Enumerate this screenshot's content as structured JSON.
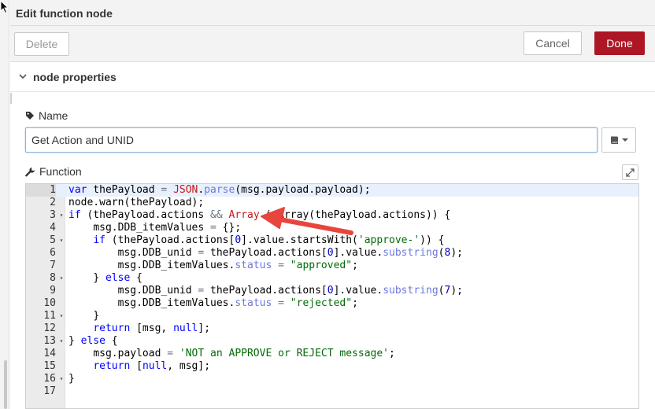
{
  "dialog": {
    "title": "Edit function node"
  },
  "toolbar": {
    "delete_label": "Delete",
    "cancel_label": "Cancel",
    "done_label": "Done"
  },
  "section": {
    "label": "node properties"
  },
  "name_field": {
    "label": "Name",
    "value": "Get Action and UNID"
  },
  "function_field": {
    "label": "Function"
  },
  "editor": {
    "line_numbers": [
      "1",
      "2",
      "3",
      "4",
      "5",
      "6",
      "7",
      "8",
      "9",
      "10",
      "11",
      "12",
      "13",
      "14",
      "15",
      "16",
      "17"
    ],
    "lines": [
      [
        [
          "k",
          "var"
        ],
        [
          "t",
          " thePayload "
        ],
        [
          "o",
          "="
        ],
        [
          "t",
          " "
        ],
        [
          "b",
          "JSON"
        ],
        [
          "t",
          "."
        ],
        [
          "c",
          "parse"
        ],
        [
          "t",
          "(msg.payload.payload);"
        ]
      ],
      [
        [
          "t",
          "node.warn(thePayload);"
        ]
      ],
      [
        [
          "k",
          "if"
        ],
        [
          "t",
          " (thePayload.actions "
        ],
        [
          "o",
          "&&"
        ],
        [
          "t",
          " "
        ],
        [
          "b",
          "Array"
        ],
        [
          "t",
          ".isArray(thePayload.actions)) {"
        ]
      ],
      [
        [
          "i",
          "    "
        ],
        [
          "t",
          "msg.DDB_itemValues "
        ],
        [
          "o",
          "="
        ],
        [
          "t",
          " {};"
        ]
      ],
      [
        [
          "i",
          "    "
        ],
        [
          "k",
          "if"
        ],
        [
          "t",
          " (thePayload.actions["
        ],
        [
          "n",
          "0"
        ],
        [
          "t",
          "].value.startsWith("
        ],
        [
          "s",
          "'approve-'"
        ],
        [
          "t",
          ")) {"
        ]
      ],
      [
        [
          "i",
          "        "
        ],
        [
          "t",
          "msg.DDB_unid "
        ],
        [
          "o",
          "="
        ],
        [
          "t",
          " thePayload.actions["
        ],
        [
          "n",
          "0"
        ],
        [
          "t",
          "].value."
        ],
        [
          "c",
          "substring"
        ],
        [
          "t",
          "("
        ],
        [
          "n",
          "8"
        ],
        [
          "t",
          ");"
        ]
      ],
      [
        [
          "i",
          "        "
        ],
        [
          "t",
          "msg.DDB_itemValues."
        ],
        [
          "c",
          "status"
        ],
        [
          "t",
          " "
        ],
        [
          "o",
          "="
        ],
        [
          "t",
          " "
        ],
        [
          "s",
          "\"approved\""
        ],
        [
          "t",
          ";"
        ]
      ],
      [
        [
          "i",
          "    "
        ],
        [
          "t",
          "} "
        ],
        [
          "k",
          "else"
        ],
        [
          "t",
          " {"
        ]
      ],
      [
        [
          "i",
          "        "
        ],
        [
          "t",
          "msg.DDB_unid "
        ],
        [
          "o",
          "="
        ],
        [
          "t",
          " thePayload.actions["
        ],
        [
          "n",
          "0"
        ],
        [
          "t",
          "].value."
        ],
        [
          "c",
          "substring"
        ],
        [
          "t",
          "("
        ],
        [
          "n",
          "7"
        ],
        [
          "t",
          ");"
        ]
      ],
      [
        [
          "i",
          "        "
        ],
        [
          "t",
          "msg.DDB_itemValues."
        ],
        [
          "c",
          "status"
        ],
        [
          "t",
          " "
        ],
        [
          "o",
          "="
        ],
        [
          "t",
          " "
        ],
        [
          "s",
          "\"rejected\""
        ],
        [
          "t",
          ";"
        ]
      ],
      [
        [
          "i",
          "    "
        ],
        [
          "t",
          "}"
        ]
      ],
      [
        [
          "i",
          "    "
        ],
        [
          "k",
          "return"
        ],
        [
          "t",
          " [msg, "
        ],
        [
          "k",
          "null"
        ],
        [
          "t",
          "];"
        ]
      ],
      [
        [
          "t",
          "} "
        ],
        [
          "k",
          "else"
        ],
        [
          "t",
          " {"
        ]
      ],
      [
        [
          "i",
          "    "
        ],
        [
          "t",
          "msg.payload "
        ],
        [
          "o",
          "="
        ],
        [
          "t",
          " "
        ],
        [
          "s",
          "'NOT an APPROVE or REJECT message'"
        ],
        [
          "t",
          ";"
        ]
      ],
      [
        [
          "i",
          "    "
        ],
        [
          "k",
          "return"
        ],
        [
          "t",
          " ["
        ],
        [
          "k",
          "null"
        ],
        [
          "t",
          ", msg];"
        ]
      ],
      [
        [
          "t",
          "}"
        ]
      ],
      [
        [
          "t",
          ""
        ]
      ]
    ],
    "fold_lines": [
      "3",
      "5",
      "8",
      "11",
      "13",
      "16"
    ],
    "active_line": "1"
  },
  "icons": {
    "tag": "tag-icon",
    "wrench": "wrench-icon",
    "chevron": "chevron-down-icon",
    "book": "book-icon",
    "expand": "expand-icon",
    "cursor": "mouse-cursor-icon"
  },
  "colors": {
    "done_button": "#ad1625",
    "annotation_arrow": "#e8453c"
  }
}
